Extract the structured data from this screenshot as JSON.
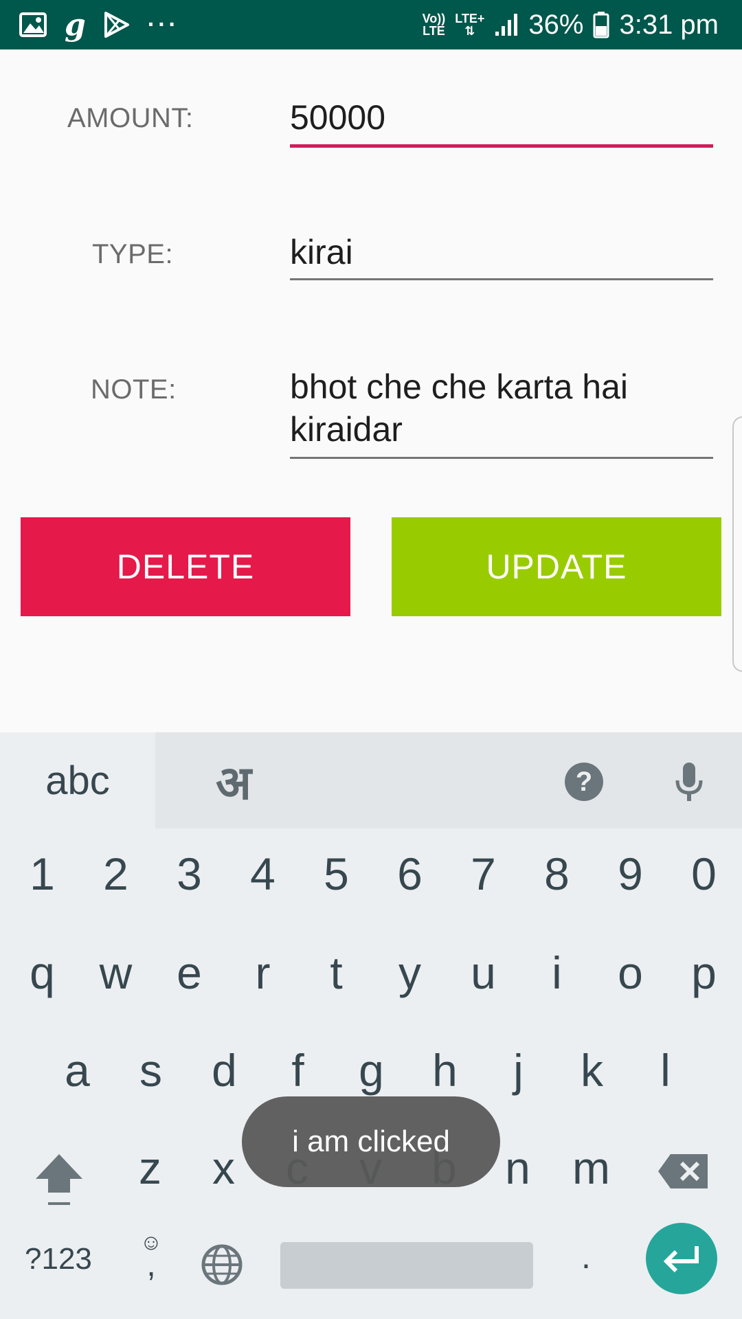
{
  "status_bar": {
    "network_top": "Vo))",
    "network_bottom": "LTE",
    "lte_plus": "LTE+",
    "battery": "36%",
    "time": "3:31 pm",
    "more": "···"
  },
  "form": {
    "amount_label": "AMOUNT:",
    "amount_value": "50000",
    "type_label": "TYPE:",
    "type_value": "kirai",
    "note_label": "NOTE:",
    "note_line1": "bhot che che karta hai",
    "note_line2": "kiraidar",
    "accent_color": "#d11d5b"
  },
  "buttons": {
    "delete_label": "DELETE",
    "update_label": "UPDATE",
    "delete_color": "#e5194a",
    "update_color": "#99cc00"
  },
  "keyboard": {
    "tab_abc": "abc",
    "tab_hindi": "अ",
    "help": "?",
    "number_row": [
      "1",
      "2",
      "3",
      "4",
      "5",
      "6",
      "7",
      "8",
      "9",
      "0"
    ],
    "row1": [
      "q",
      "w",
      "e",
      "r",
      "t",
      "y",
      "u",
      "i",
      "o",
      "p"
    ],
    "row2": [
      "a",
      "s",
      "d",
      "f",
      "g",
      "h",
      "j",
      "k",
      "l"
    ],
    "row3": [
      "z",
      "x",
      "c",
      "v",
      "b",
      "n",
      "m"
    ],
    "symbols_label": "?123",
    "emoji_label": "☺",
    "comma_label": ",",
    "period_label": "."
  },
  "toast": {
    "message": "i am clicked"
  }
}
